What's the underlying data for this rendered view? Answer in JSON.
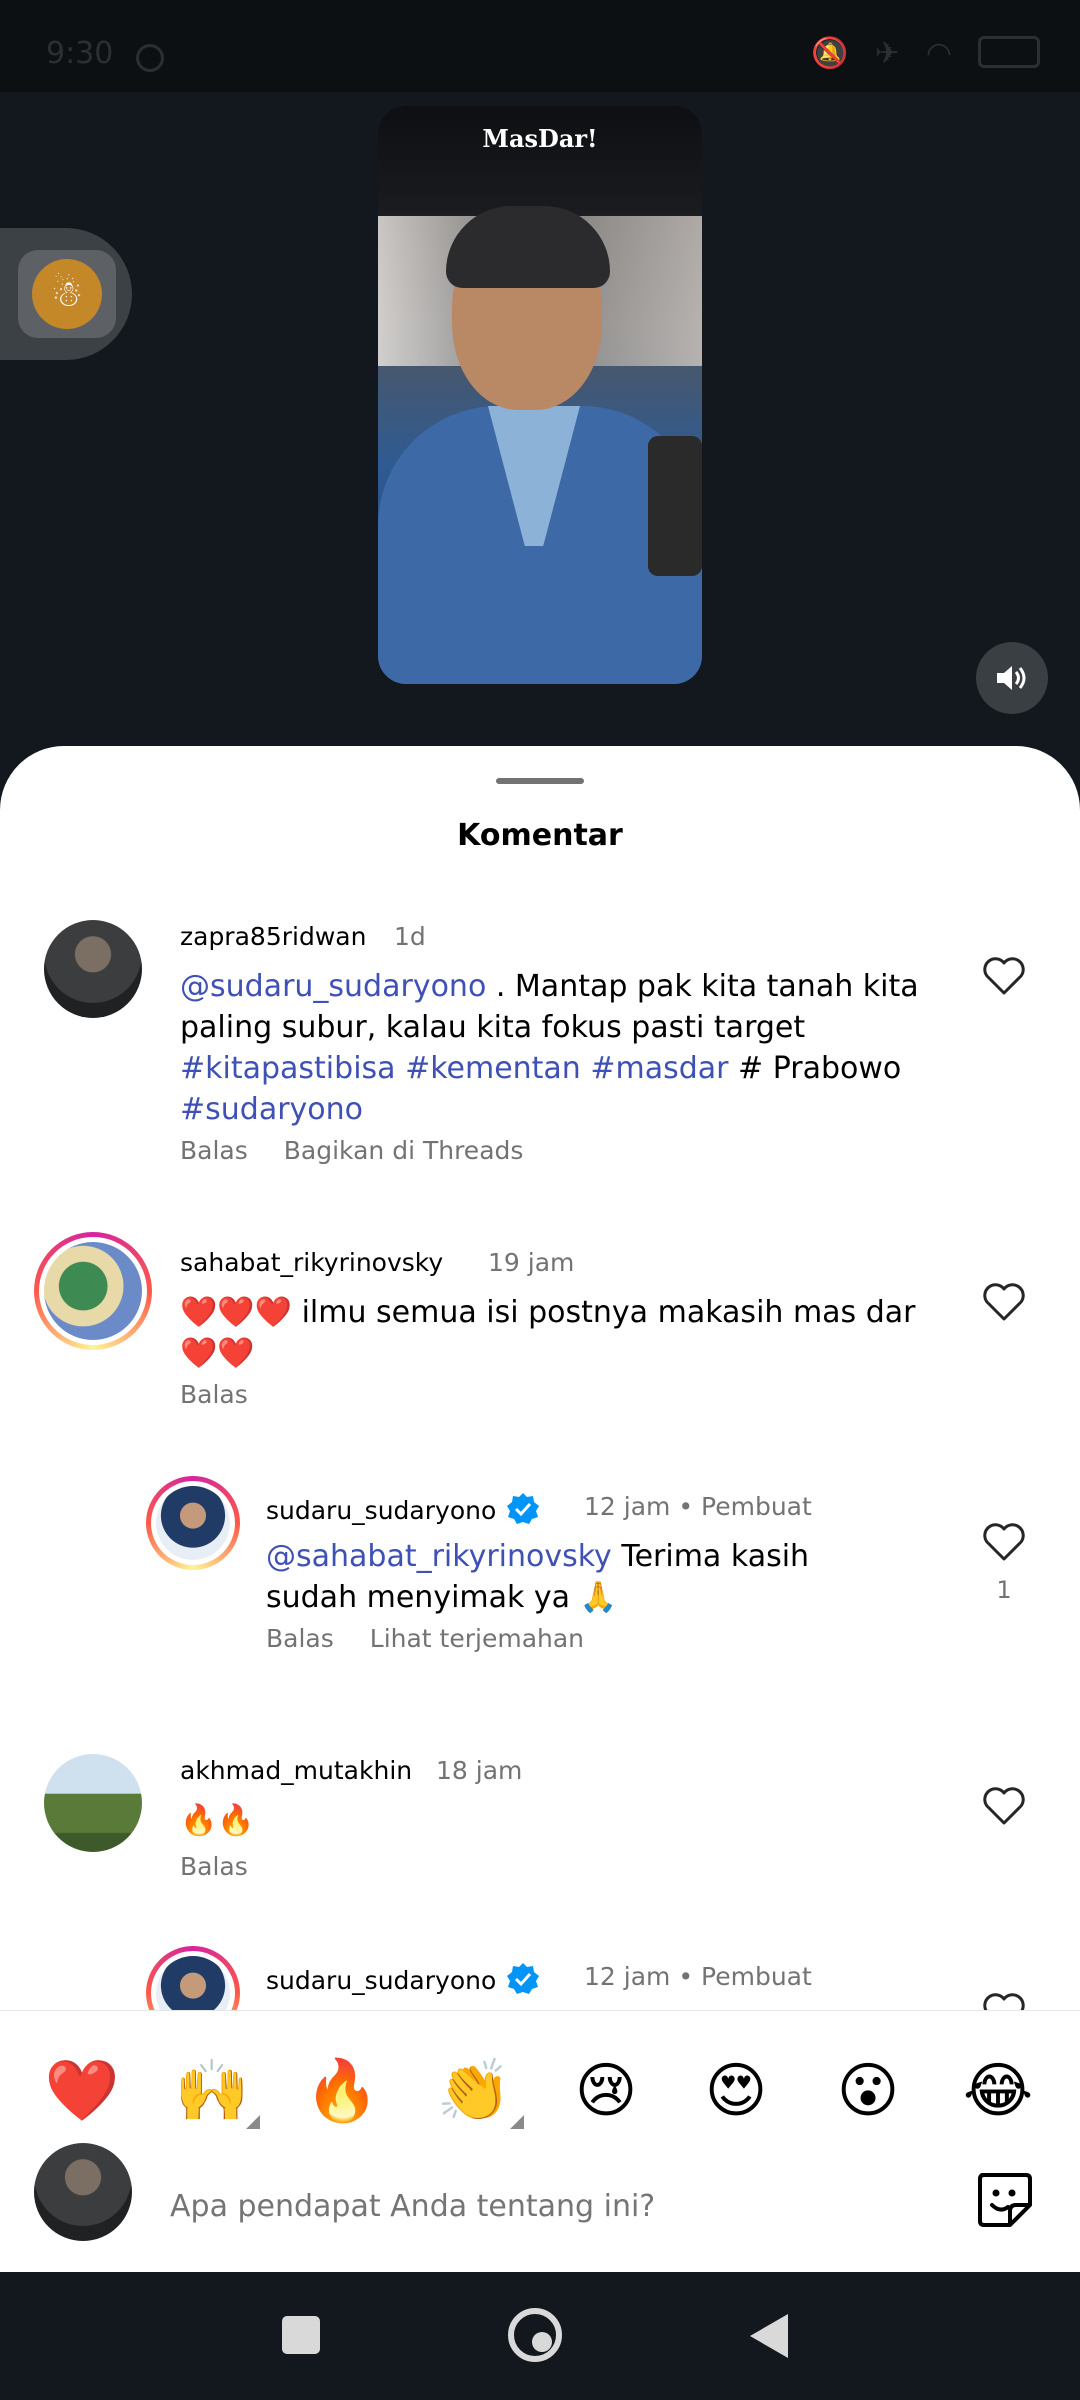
{
  "status_bar": {
    "time": "9:30"
  },
  "video": {
    "logo_text": "MasDar!"
  },
  "sheet": {
    "title": "Komentar"
  },
  "comments": [
    {
      "username": "zapra85ridwan",
      "time": "1d",
      "mention": "@sudaru_sudaryono",
      "text_1": " . Mantap pak kita tanah kita paling subur, kalau kita  fokus pasti target ",
      "hashtags": "#kitapastibisa #kementan #masdar",
      "text_2": " # Prabowo ",
      "hashtag_2": "#sudaryono",
      "reply_label": "Balas",
      "share_label": "Bagikan di Threads"
    },
    {
      "username": "sahabat_rikyrinovsky",
      "time": "19 jam",
      "text": "❤️❤️❤️ ilmu semua isi postnya makasih mas dar ❤️❤️",
      "reply_label": "Balas"
    },
    {
      "username": "sudaru_sudaryono",
      "time": "12 jam",
      "creator_tag": "• Pembuat",
      "mention": "@sahabat_rikyrinovsky",
      "text": " Terima kasih sudah menyimak ya 🙏",
      "like_count": "1",
      "reply_label": "Balas",
      "translate_label": "Lihat terjemahan"
    },
    {
      "username": "akhmad_mutakhin",
      "time": "18 jam",
      "text": "🔥🔥",
      "reply_label": "Balas"
    },
    {
      "username": "sudaru_sudaryono",
      "time": "12 jam",
      "creator_tag": "• Pembuat"
    }
  ],
  "emoji_bar": [
    "❤️",
    "🙌",
    "🔥",
    "👏",
    "😢",
    "😍",
    "😮",
    "😂"
  ],
  "comment_input": {
    "placeholder": "Apa pendapat Anda tentang ini?"
  },
  "colors": {
    "mention": "#3f51b5",
    "verified": "#0095f6",
    "sheet_bg": "#ffffff",
    "dark_bg": "#12181d"
  }
}
